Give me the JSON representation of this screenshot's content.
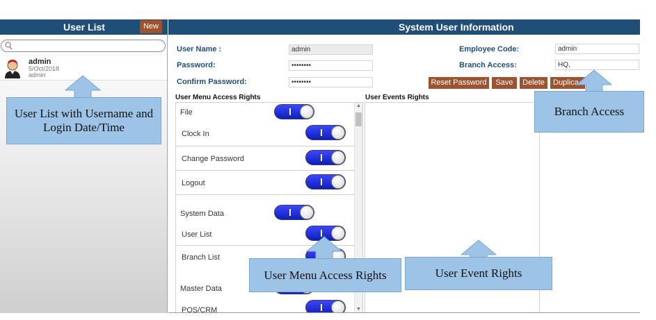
{
  "left_panel": {
    "title": "User List",
    "new_button": "New",
    "search_placeholder": "",
    "users": [
      {
        "name": "admin",
        "date": "5/Oct/2018",
        "login": "admin"
      }
    ]
  },
  "right_panel": {
    "title": "System User Information",
    "labels": {
      "username": "User Name :",
      "password": "Password:",
      "confirm_password": "Confirm Password:",
      "employee_code": "Employee Code:",
      "branch_access": "Branch Access:"
    },
    "values": {
      "username": "admin",
      "password": "••••••••",
      "confirm_password": "••••••••",
      "employee_code": "admin",
      "branch_access": "HQ,"
    },
    "buttons": {
      "reset_password": "Reset Password",
      "save": "Save",
      "delete": "Delete",
      "duplicate": "Duplica"
    },
    "menu_title": "User Menu Access Rights",
    "events_title": "User Events Rights",
    "menu_items": [
      {
        "label": "File",
        "on": true
      },
      {
        "label": "Clock In",
        "on": true
      },
      {
        "label": "Change Password",
        "on": true
      },
      {
        "label": "Logout",
        "on": true
      },
      {
        "label": "System Data",
        "on": true
      },
      {
        "label": "User List",
        "on": true
      },
      {
        "label": "Branch List",
        "on": true
      },
      {
        "label": "Master Data",
        "on": true
      },
      {
        "label": "POS/CRM",
        "on": true
      }
    ]
  },
  "callouts": {
    "user_list": "User List with Username and Login Date/Time",
    "branch_access": "Branch Access",
    "menu_rights": "User Menu Access Rights",
    "event_rights": "User Event Rights"
  },
  "colors": {
    "header_bg": "#1f4e79",
    "button_bg": "#a0522d",
    "label_color": "#1f4e79",
    "callout_bg": "#9dc3e6",
    "toggle_on": "#2a35e0"
  }
}
